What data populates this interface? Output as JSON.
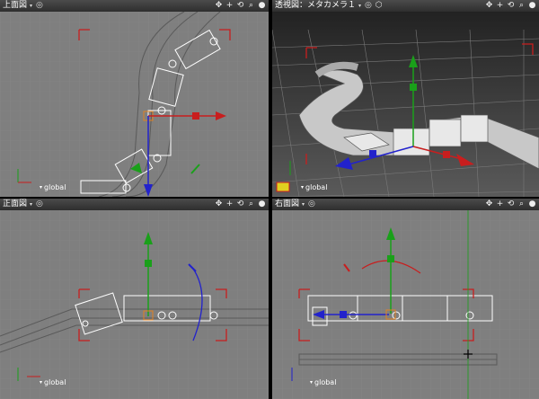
{
  "viewports": {
    "top": {
      "title": "上面図",
      "coord": "global"
    },
    "persp": {
      "title": "透視図：メタカメラ１",
      "coord": "global"
    },
    "front": {
      "title": "正面図",
      "coord": "global"
    },
    "right": {
      "title": "右面図",
      "coord": "global"
    }
  },
  "icons": {
    "dropdown": "▾",
    "target": "◎",
    "cube": "⬡",
    "move": "✥",
    "zoom_in": "+",
    "rotate": "⟲",
    "zoom": "⌕",
    "sphere": "●"
  },
  "colors": {
    "bg": "#7f7f7f",
    "grid": "#8a8a8a",
    "x": "#c81e1e",
    "y": "#1aa01a",
    "z": "#2222cc",
    "wire": "#ffffff"
  }
}
